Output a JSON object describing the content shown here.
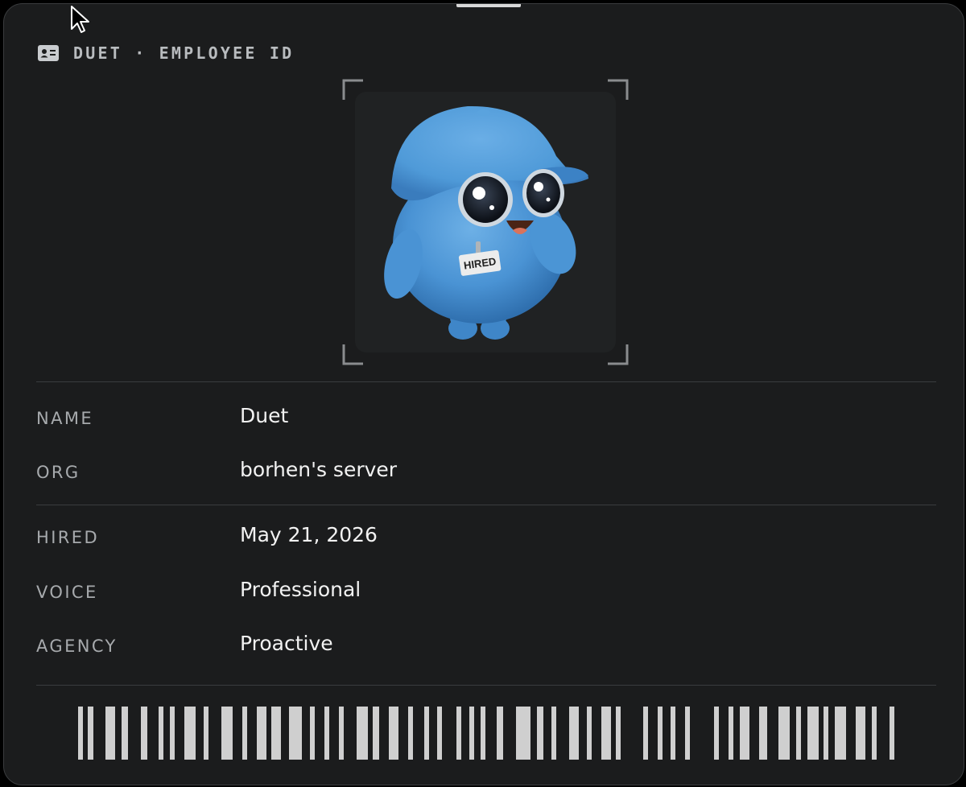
{
  "header": {
    "title": "DUET · EMPLOYEE ID",
    "icon": "id-card-icon"
  },
  "portrait": {
    "subject": "mascot-avatar",
    "badge_text": "HIRED",
    "colors": {
      "body": "#4a93d4",
      "cap": "#4f9ad8",
      "frame_corners": "#8a8c8e"
    }
  },
  "fields": [
    {
      "label": "NAME",
      "value": "Duet"
    },
    {
      "label": "ORG",
      "value": "borhen's server"
    },
    {
      "label": "HIRED",
      "value": "May 21, 2026"
    },
    {
      "label": "VOICE",
      "value": "Professional"
    },
    {
      "label": "AGENCY",
      "value": "Proactive"
    }
  ],
  "barcode": {
    "color": "#cfcfcf"
  },
  "colors": {
    "card_background": "#1b1c1d",
    "label": "#a7aaad",
    "value": "#f2f2f2",
    "header": "#b9bcbf"
  }
}
